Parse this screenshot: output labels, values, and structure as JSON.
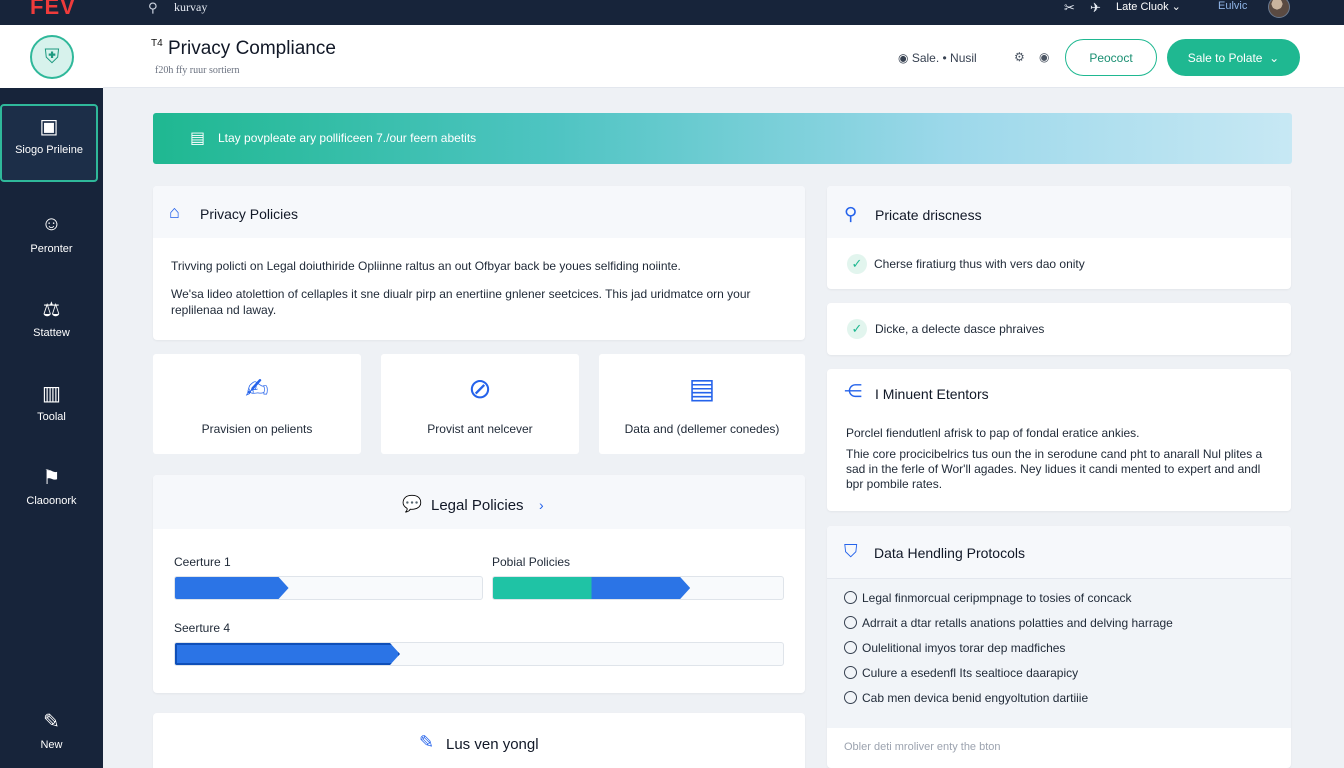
{
  "topbar": {
    "brand": "FEV",
    "search_label": "kurvay",
    "account": "Late Cluok",
    "user": "Eulvic"
  },
  "sidebar": {
    "items": [
      {
        "label": "Siogo Prileine"
      },
      {
        "label": "Peronter"
      },
      {
        "label": "Stattew"
      },
      {
        "label": "Toolal"
      },
      {
        "label": "Claoonork"
      },
      {
        "label": "New"
      }
    ]
  },
  "header": {
    "title_mark": "T4",
    "title": "Privacy Compliance",
    "subtitle": "f20h ffy ruur sortiern",
    "status": "Sale. • Nusil",
    "outline_button": "Peococt",
    "primary_button": "Sale to Polate"
  },
  "banner": {
    "text": "Ltay povpleate ary pollificeen   7./our feern abetits"
  },
  "privacy_policies": {
    "title": "Privacy Policies",
    "p1": "Trivving policti on Legal doiuthiride Opliinne raltus an out Ofbyar back be youes selfiding noiinte.",
    "p2": "We'sa lideo atolettion of cellaples it sne diualr pirp an enertiine gnlener seetcices. This jad uridmatce orn your replilenaa nd laway."
  },
  "tiles": [
    {
      "label": "Pravisien on pelients"
    },
    {
      "label": "Provist ant nelcever"
    },
    {
      "label": "Data and (dellemer conedes)"
    }
  ],
  "legal_policies": {
    "title": "Legal Policies",
    "bars": [
      {
        "label": "Ceerture 1",
        "progress": 0.37
      },
      {
        "label": "Pobial Policies",
        "progress": 0.68
      },
      {
        "label": "Seerture 4",
        "progress": 0.37
      }
    ]
  },
  "bottom_card": {
    "title": "Lus ven yongl"
  },
  "private_discness": {
    "title": "Pricate driscness",
    "items": [
      "Cherse firatiurg thus with vers dao onity",
      "Dicke, a delecte dasce phraives"
    ]
  },
  "events": {
    "title": "I Minuent Etentors",
    "line1": "Porclel fiendutlenl afrisk to pap of fondal eratice ankies.",
    "line2": "Thie core procicibelrics tus oun the in serodune cand pht to anarall Nul plites a sad in the ferle of Wor'll agades. Ney lidues it candi mented to expert and andl bpr pombile rates."
  },
  "data_handling": {
    "title": "Data Hendling Protocols",
    "options": [
      "Legal finmorcual ceripmpnage to tosies of concack",
      "Adrrait a dtar retalls anations polatties and delving harrage",
      "Oulelitional imyos torar dep madfiches",
      "Culure a esedenfl Its sealtioce daarapicy",
      "Cab men devica benid engyoltution dartiiie"
    ],
    "footer": "Obler deti mroliver enty the bton"
  },
  "colors": {
    "accent": "#1fb891",
    "nav_bg": "#17243a",
    "bar_blue": "#2b74e6",
    "bar_teal": "#1fc3a5"
  }
}
